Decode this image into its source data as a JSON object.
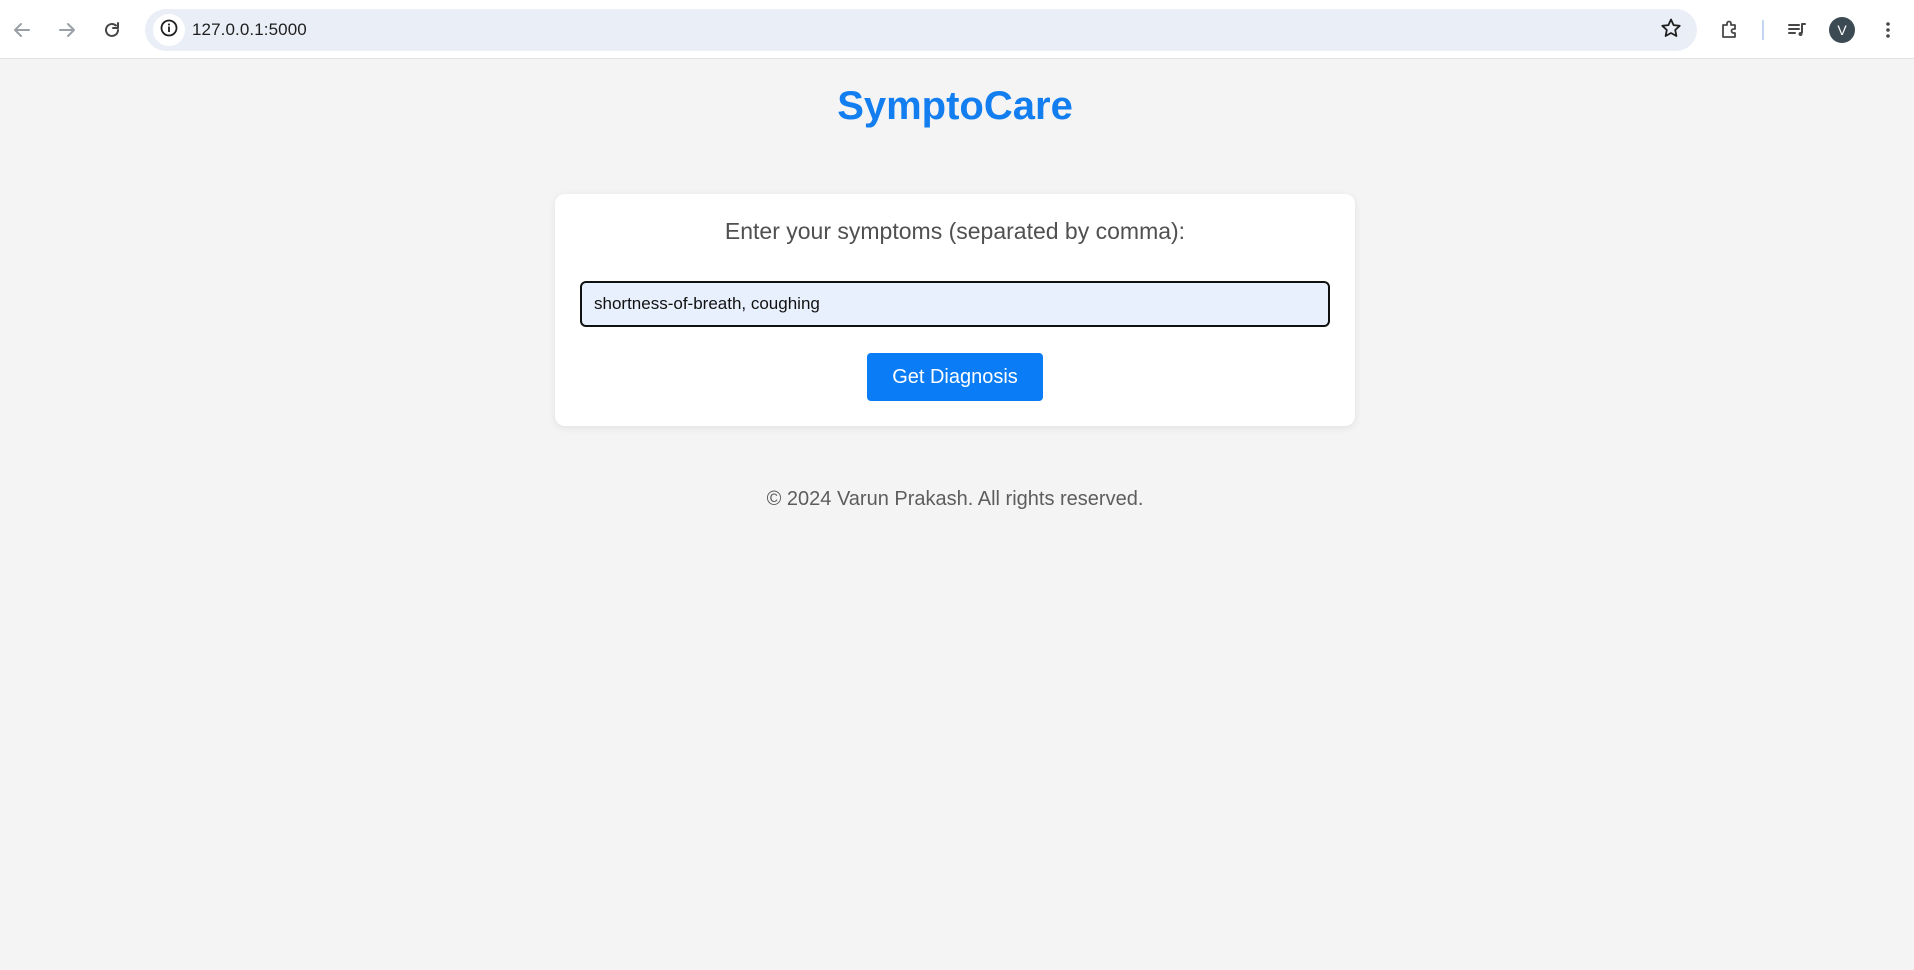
{
  "browser": {
    "url": "127.0.0.1:5000",
    "profile_initial": "V",
    "icons": {
      "back": "back-arrow-icon",
      "forward": "forward-arrow-icon",
      "reload": "reload-icon",
      "site_info": "info-icon",
      "bookmark": "star-icon",
      "extensions": "puzzle-icon",
      "media": "media-queue-icon",
      "menu": "kebab-menu-icon"
    }
  },
  "page": {
    "title": "SymptoCare",
    "title_color": "#127ef0",
    "form": {
      "label": "Enter your symptoms (separated by comma):",
      "input_value": "shortness-of-breath, coughing",
      "button_label": "Get Diagnosis",
      "button_color": "#0a7cf5"
    },
    "footer": "© 2024 Varun Prakash. All rights reserved."
  }
}
